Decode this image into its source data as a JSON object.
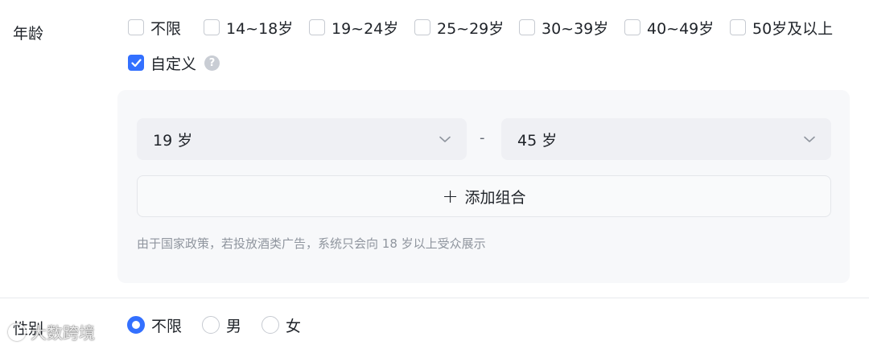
{
  "age": {
    "label": "年龄",
    "options": [
      {
        "label": "不限",
        "checked": false
      },
      {
        "label": "14~18岁",
        "checked": false
      },
      {
        "label": "19~24岁",
        "checked": false
      },
      {
        "label": "25~29岁",
        "checked": false
      },
      {
        "label": "30~39岁",
        "checked": false
      },
      {
        "label": "40~49岁",
        "checked": false
      },
      {
        "label": "50岁及以上",
        "checked": false
      }
    ],
    "custom": {
      "label": "自定义",
      "checked": true,
      "help_glyph": "?"
    },
    "range": {
      "from": "19 岁",
      "separator": "-",
      "to": "45 岁"
    },
    "add_combo_label": "添加组合",
    "policy_note": "由于国家政策，若投放酒类广告，系统只会向 18 岁以上受众展示"
  },
  "gender": {
    "label": "性别",
    "options": [
      {
        "label": "不限",
        "selected": true
      },
      {
        "label": "男",
        "selected": false
      },
      {
        "label": "女",
        "selected": false
      }
    ]
  },
  "watermark": {
    "text": "大数跨境"
  },
  "colors": {
    "accent": "#3370ff",
    "panel_bg": "#f7f8fa",
    "muted_text": "#8f959e"
  }
}
